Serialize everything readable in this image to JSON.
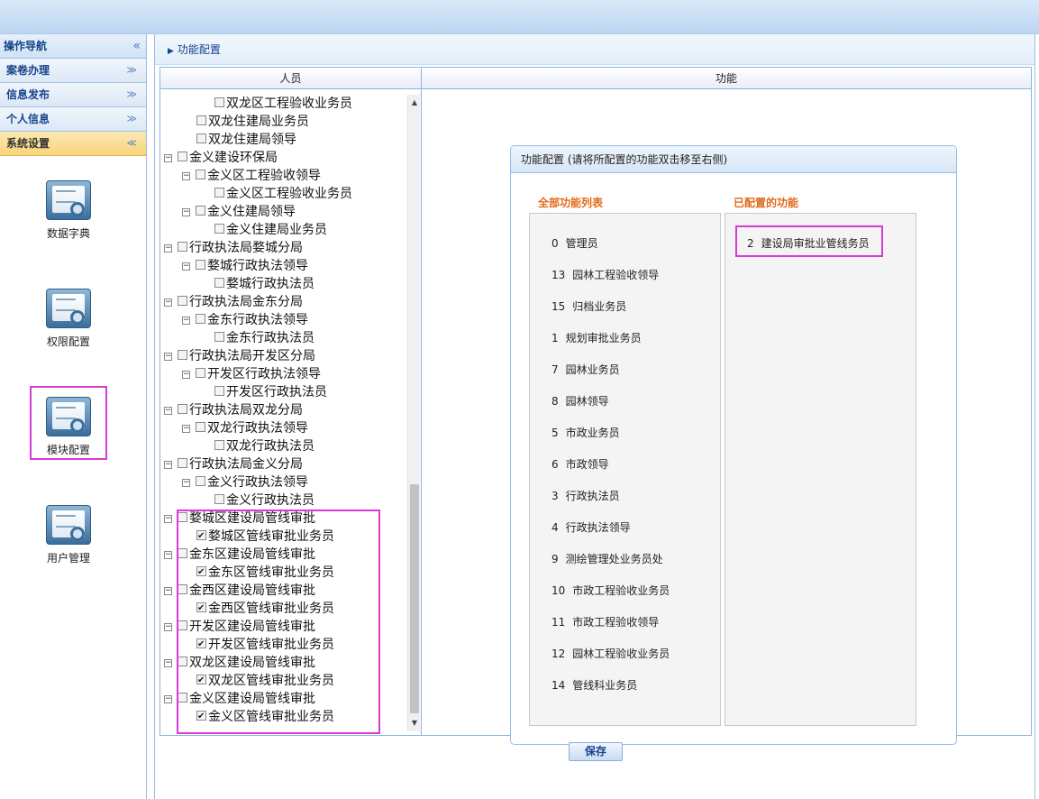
{
  "sidebar": {
    "title": "操作导航",
    "collapse_glyph": "«",
    "groups": [
      {
        "label": "案卷办理",
        "chevron": "≫"
      },
      {
        "label": "信息发布",
        "chevron": "≫"
      },
      {
        "label": "个人信息",
        "chevron": "≫"
      },
      {
        "label": "系统设置",
        "chevron": "≪",
        "active": true
      }
    ],
    "tiles": [
      {
        "label": "数据字典",
        "icon": "data-dictionary-icon"
      },
      {
        "label": "权限配置",
        "icon": "permission-config-icon",
        "highlighted": true
      },
      {
        "label": "模块配置",
        "icon": "module-config-icon"
      },
      {
        "label": "用户管理",
        "icon": "user-management-icon"
      }
    ]
  },
  "breadcrumb": "功能配置",
  "grid": {
    "col_people": "人员",
    "col_functions": "功能"
  },
  "tree": [
    {
      "label": "双龙区工程验收业务员",
      "level": 3,
      "toggle": false,
      "checked": false
    },
    {
      "label": "双龙住建局业务员",
      "level": 2,
      "toggle": false,
      "checked": false
    },
    {
      "label": "双龙住建局领导",
      "level": 2,
      "toggle": false,
      "checked": false
    },
    {
      "label": "金义建设环保局",
      "level": 1,
      "toggle": true,
      "checked": false
    },
    {
      "label": "金义区工程验收领导",
      "level": 2,
      "toggle": true,
      "checked": false
    },
    {
      "label": "金义区工程验收业务员",
      "level": 3,
      "toggle": false,
      "checked": false
    },
    {
      "label": "金义住建局领导",
      "level": 2,
      "toggle": true,
      "checked": false
    },
    {
      "label": "金义住建局业务员",
      "level": 3,
      "toggle": false,
      "checked": false
    },
    {
      "label": "行政执法局婺城分局",
      "level": 1,
      "toggle": true,
      "checked": false
    },
    {
      "label": "婺城行政执法领导",
      "level": 2,
      "toggle": true,
      "checked": false
    },
    {
      "label": "婺城行政执法员",
      "level": 3,
      "toggle": false,
      "checked": false
    },
    {
      "label": "行政执法局金东分局",
      "level": 1,
      "toggle": true,
      "checked": false
    },
    {
      "label": "金东行政执法领导",
      "level": 2,
      "toggle": true,
      "checked": false
    },
    {
      "label": "金东行政执法员",
      "level": 3,
      "toggle": false,
      "checked": false
    },
    {
      "label": "行政执法局开发区分局",
      "level": 1,
      "toggle": true,
      "checked": false
    },
    {
      "label": "开发区行政执法领导",
      "level": 2,
      "toggle": true,
      "checked": false
    },
    {
      "label": "开发区行政执法员",
      "level": 3,
      "toggle": false,
      "checked": false
    },
    {
      "label": "行政执法局双龙分局",
      "level": 1,
      "toggle": true,
      "checked": false
    },
    {
      "label": "双龙行政执法领导",
      "level": 2,
      "toggle": true,
      "checked": false
    },
    {
      "label": "双龙行政执法员",
      "level": 3,
      "toggle": false,
      "checked": false
    },
    {
      "label": "行政执法局金义分局",
      "level": 1,
      "toggle": true,
      "checked": false
    },
    {
      "label": "金义行政执法领导",
      "level": 2,
      "toggle": true,
      "checked": false
    },
    {
      "label": "金义行政执法员",
      "level": 3,
      "toggle": false,
      "checked": false
    },
    {
      "label": "婺城区建设局管线审批",
      "level": 1,
      "toggle": true,
      "checked": false
    },
    {
      "label": "婺城区管线审批业务员",
      "level": 2,
      "toggle": false,
      "checked": true
    },
    {
      "label": "金东区建设局管线审批",
      "level": 1,
      "toggle": true,
      "checked": false
    },
    {
      "label": "金东区管线审批业务员",
      "level": 2,
      "toggle": false,
      "checked": true
    },
    {
      "label": "金西区建设局管线审批",
      "level": 1,
      "toggle": true,
      "checked": false
    },
    {
      "label": "金西区管线审批业务员",
      "level": 2,
      "toggle": false,
      "checked": true
    },
    {
      "label": "开发区建设局管线审批",
      "level": 1,
      "toggle": true,
      "checked": false
    },
    {
      "label": "开发区管线审批业务员",
      "level": 2,
      "toggle": false,
      "checked": true
    },
    {
      "label": "双龙区建设局管线审批",
      "level": 1,
      "toggle": true,
      "checked": false
    },
    {
      "label": "双龙区管线审批业务员",
      "level": 2,
      "toggle": false,
      "checked": true
    },
    {
      "label": "金义区建设局管线审批",
      "level": 1,
      "toggle": true,
      "checked": false
    },
    {
      "label": "金义区管线审批业务员",
      "level": 2,
      "toggle": false,
      "checked": true
    }
  ],
  "function_panel": {
    "title": "功能配置 (请将所配置的功能双击移至右侧)",
    "all_title": "全部功能列表",
    "configured_title": "已配置的功能",
    "all_functions": [
      {
        "id": "0",
        "name": "管理员"
      },
      {
        "id": "13",
        "name": "园林工程验收领导"
      },
      {
        "id": "15",
        "name": "归档业务员"
      },
      {
        "id": "1",
        "name": "规划审批业务员"
      },
      {
        "id": "7",
        "name": "园林业务员"
      },
      {
        "id": "8",
        "name": "园林领导"
      },
      {
        "id": "5",
        "name": "市政业务员"
      },
      {
        "id": "6",
        "name": "市政领导"
      },
      {
        "id": "3",
        "name": "行政执法员"
      },
      {
        "id": "4",
        "name": "行政执法领导"
      },
      {
        "id": "9",
        "name": "测绘管理处业务员处"
      },
      {
        "id": "10",
        "name": "市政工程验收业务员"
      },
      {
        "id": "11",
        "name": "市政工程验收领导"
      },
      {
        "id": "12",
        "name": "园林工程验收业务员"
      },
      {
        "id": "14",
        "name": "管线科业务员"
      }
    ],
    "configured_functions": [
      {
        "id": "2",
        "name": "建设局审批业管线务员"
      }
    ]
  },
  "save_label": "保存",
  "colors": {
    "highlight": "#d63bd6",
    "list_title": "#e06a1b",
    "accent_blue": "#15428b"
  }
}
